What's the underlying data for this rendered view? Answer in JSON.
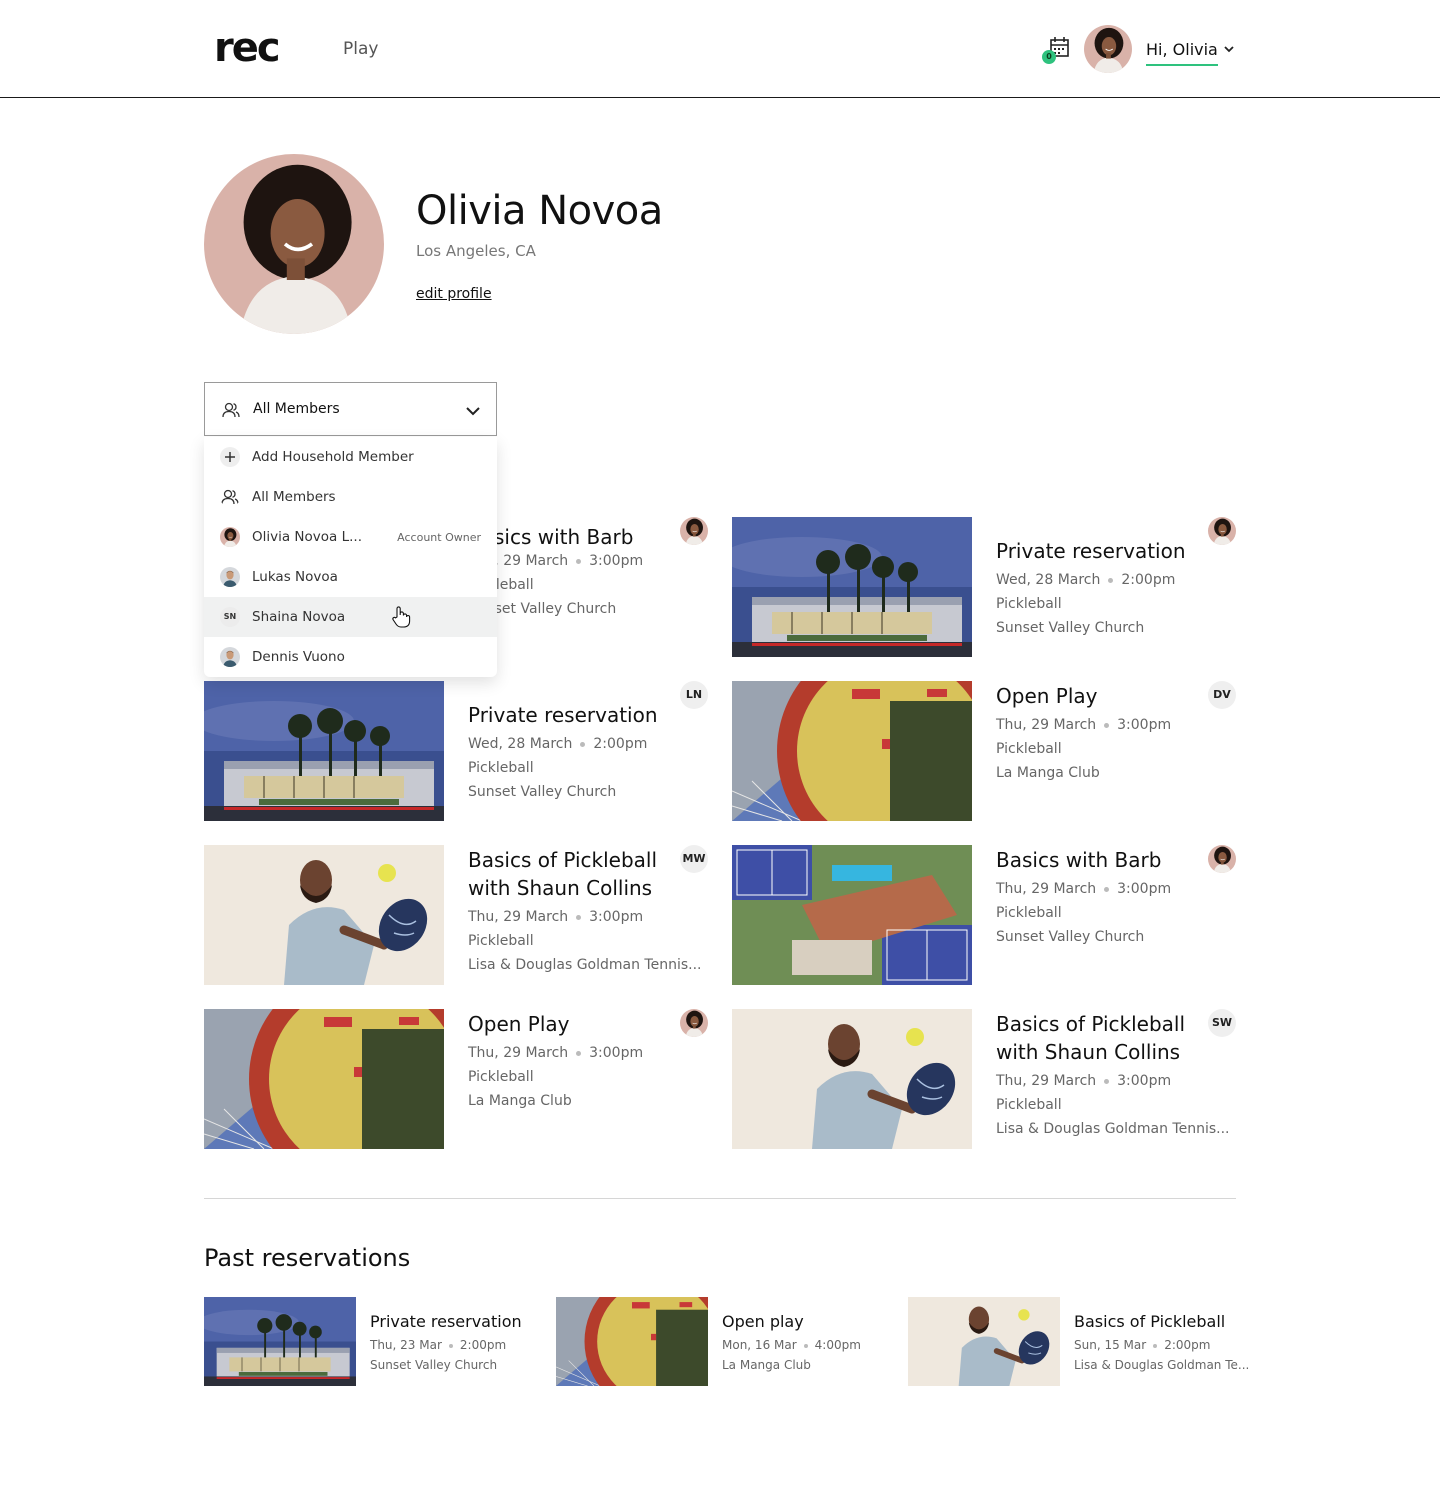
{
  "header": {
    "logo": "rec",
    "nav_play": "Play",
    "calendar_count": "0",
    "greeting": "Hi, Olivia"
  },
  "profile": {
    "name": "Olivia Novoa",
    "location": "Los Angeles, CA",
    "edit_label": "edit profile"
  },
  "member_select": {
    "selected": "All Members",
    "options": [
      {
        "label": "Add Household Member",
        "icon": "plus-icon"
      },
      {
        "label": "All Members",
        "icon": "users-icon"
      },
      {
        "label": "Olivia Novoa L...",
        "role": "Account Owner",
        "icon": "avatar"
      },
      {
        "label": "Lukas Novoa",
        "icon": "avatar"
      },
      {
        "label": "Shaina Novoa",
        "initials": "SN"
      },
      {
        "label": "Dennis Vuono",
        "icon": "avatar"
      }
    ]
  },
  "upcoming": [
    {
      "title": "Basics with Barb",
      "date": "Thu, 29 March",
      "time": "3:00pm",
      "sport": "Pickleball",
      "venue": "Sunset Valley Church",
      "who": "avatar",
      "image": "pool"
    },
    {
      "title": "Private reservation",
      "date": "Wed, 28 March",
      "time": "2:00pm",
      "sport": "Pickleball",
      "venue": "Sunset Valley Church",
      "who": "avatar",
      "image": "building"
    },
    {
      "title": "Private reservation",
      "date": "Wed, 28 March",
      "time": "2:00pm",
      "sport": "Pickleball",
      "venue": "Sunset Valley Church",
      "who": "LN",
      "image": "building"
    },
    {
      "title": "Open Play",
      "date": "Thu, 29 March",
      "time": "3:00pm",
      "sport": "Pickleball",
      "venue": "La Manga Club",
      "who": "DV",
      "image": "court"
    },
    {
      "title": "Basics of Pickleball with Shaun Collins",
      "date": "Thu, 29 March",
      "time": "3:00pm",
      "sport": "Pickleball",
      "venue": "Lisa & Douglas Goldman Tennis...",
      "who": "MW",
      "image": "player"
    },
    {
      "title": "Basics with Barb",
      "date": "Thu, 29 March",
      "time": "3:00pm",
      "sport": "Pickleball",
      "venue": "Sunset Valley Church",
      "who": "avatar",
      "image": "pool"
    },
    {
      "title": "Open Play",
      "date": "Thu, 29 March",
      "time": "3:00pm",
      "sport": "Pickleball",
      "venue": "La Manga Club",
      "who": "avatar",
      "image": "court"
    },
    {
      "title": "Basics of Pickleball with Shaun Collins",
      "date": "Thu, 29 March",
      "time": "3:00pm",
      "sport": "Pickleball",
      "venue": "Lisa & Douglas Goldman Tennis...",
      "who": "SW",
      "image": "player"
    }
  ],
  "past_section_title": "Past reservations",
  "past": [
    {
      "title": "Private reservation",
      "date": "Thu, 23 Mar",
      "time": "2:00pm",
      "venue": "Sunset Valley Church",
      "image": "building"
    },
    {
      "title": "Open play",
      "date": "Mon, 16 Mar",
      "time": "4:00pm",
      "venue": "La Manga Club",
      "image": "court"
    },
    {
      "title": "Basics of Pickleball",
      "date": "Sun,  15 Mar",
      "time": "2:00pm",
      "venue": "Lisa & Douglas Goldman Te...",
      "image": "player"
    }
  ],
  "colors": {
    "accent": "#2ec27e",
    "text": "#111111",
    "muted": "#666666",
    "avatar_bg": "#d9b2a9"
  }
}
